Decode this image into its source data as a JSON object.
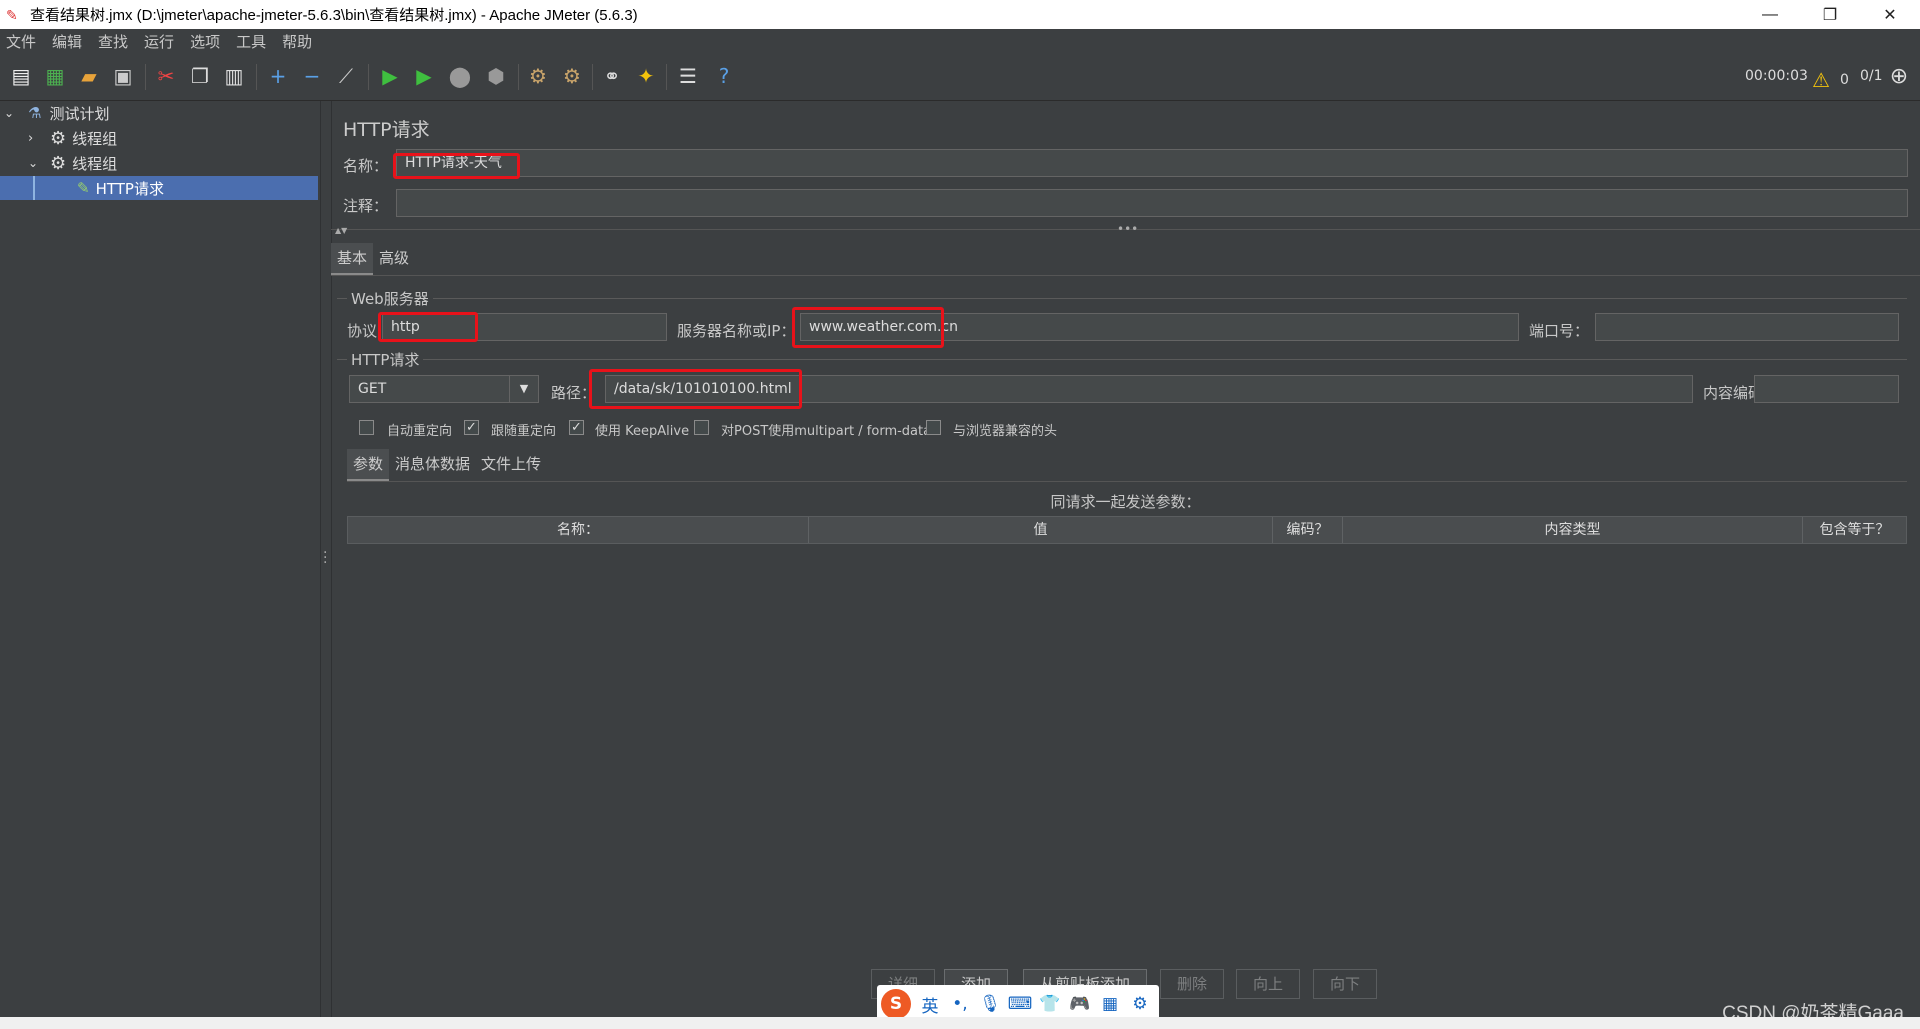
{
  "window": {
    "title": "查看结果树.jmx (D:\\jmeter\\apache-jmeter-5.6.3\\bin\\查看结果树.jmx) - Apache JMeter (5.6.3)",
    "minimize": "—",
    "maximize": "❐",
    "close": "✕"
  },
  "menu": [
    "文件",
    "编辑",
    "查找",
    "运行",
    "选项",
    "工具",
    "帮助"
  ],
  "toolbar_status": {
    "elapsed": "00:00:03",
    "warnings": "0",
    "threads": "0/1"
  },
  "tree": {
    "items": [
      {
        "label": "测试计划",
        "icon": "flask-icon"
      },
      {
        "label": "线程组",
        "icon": "gear-icon"
      },
      {
        "label": "线程组",
        "icon": "gear-icon"
      },
      {
        "label": "HTTP请求",
        "icon": "pipette-icon",
        "selected": true
      }
    ]
  },
  "panel": {
    "title": "HTTP请求",
    "name_label": "名称：",
    "name_value": "HTTP请求-天气",
    "comment_label": "注释：",
    "comment_value": "",
    "tabs": [
      "基本",
      "高级"
    ],
    "web_server": {
      "legend": "Web服务器",
      "protocol_label": "协议",
      "protocol_value": "http",
      "server_label": "服务器名称或IP：",
      "server_value": "www.weather.com.cn",
      "port_label": "端口号：",
      "port_value": ""
    },
    "http_request": {
      "legend": "HTTP请求",
      "method": "GET",
      "path_label": "路径：",
      "path_value": "/data/sk/101010100.html",
      "encoding_label": "内容编码：",
      "encoding_value": ""
    },
    "options": [
      {
        "label": "自动重定向",
        "checked": false
      },
      {
        "label": "跟随重定向",
        "checked": true
      },
      {
        "label": "使用 KeepAlive",
        "checked": true
      },
      {
        "label": "对POST使用multipart / form-data",
        "checked": false
      },
      {
        "label": "与浏览器兼容的头",
        "checked": false
      }
    ],
    "sub_tabs": [
      "参数",
      "消息体数据",
      "文件上传"
    ],
    "params_caption": "同请求一起发送参数：",
    "columns": [
      "名称：",
      "值",
      "编码？",
      "内容类型",
      "包含等于？"
    ],
    "buttons": [
      "详细",
      "添加",
      "从剪贴板添加",
      "删除",
      "向上",
      "向下"
    ]
  },
  "ime": {
    "label": "英"
  },
  "watermark": "CSDN @奶茶精Gaaa",
  "colors": {
    "background": "#3c3f41",
    "selection": "#4b6eaf",
    "highlight": "#e8121a"
  }
}
